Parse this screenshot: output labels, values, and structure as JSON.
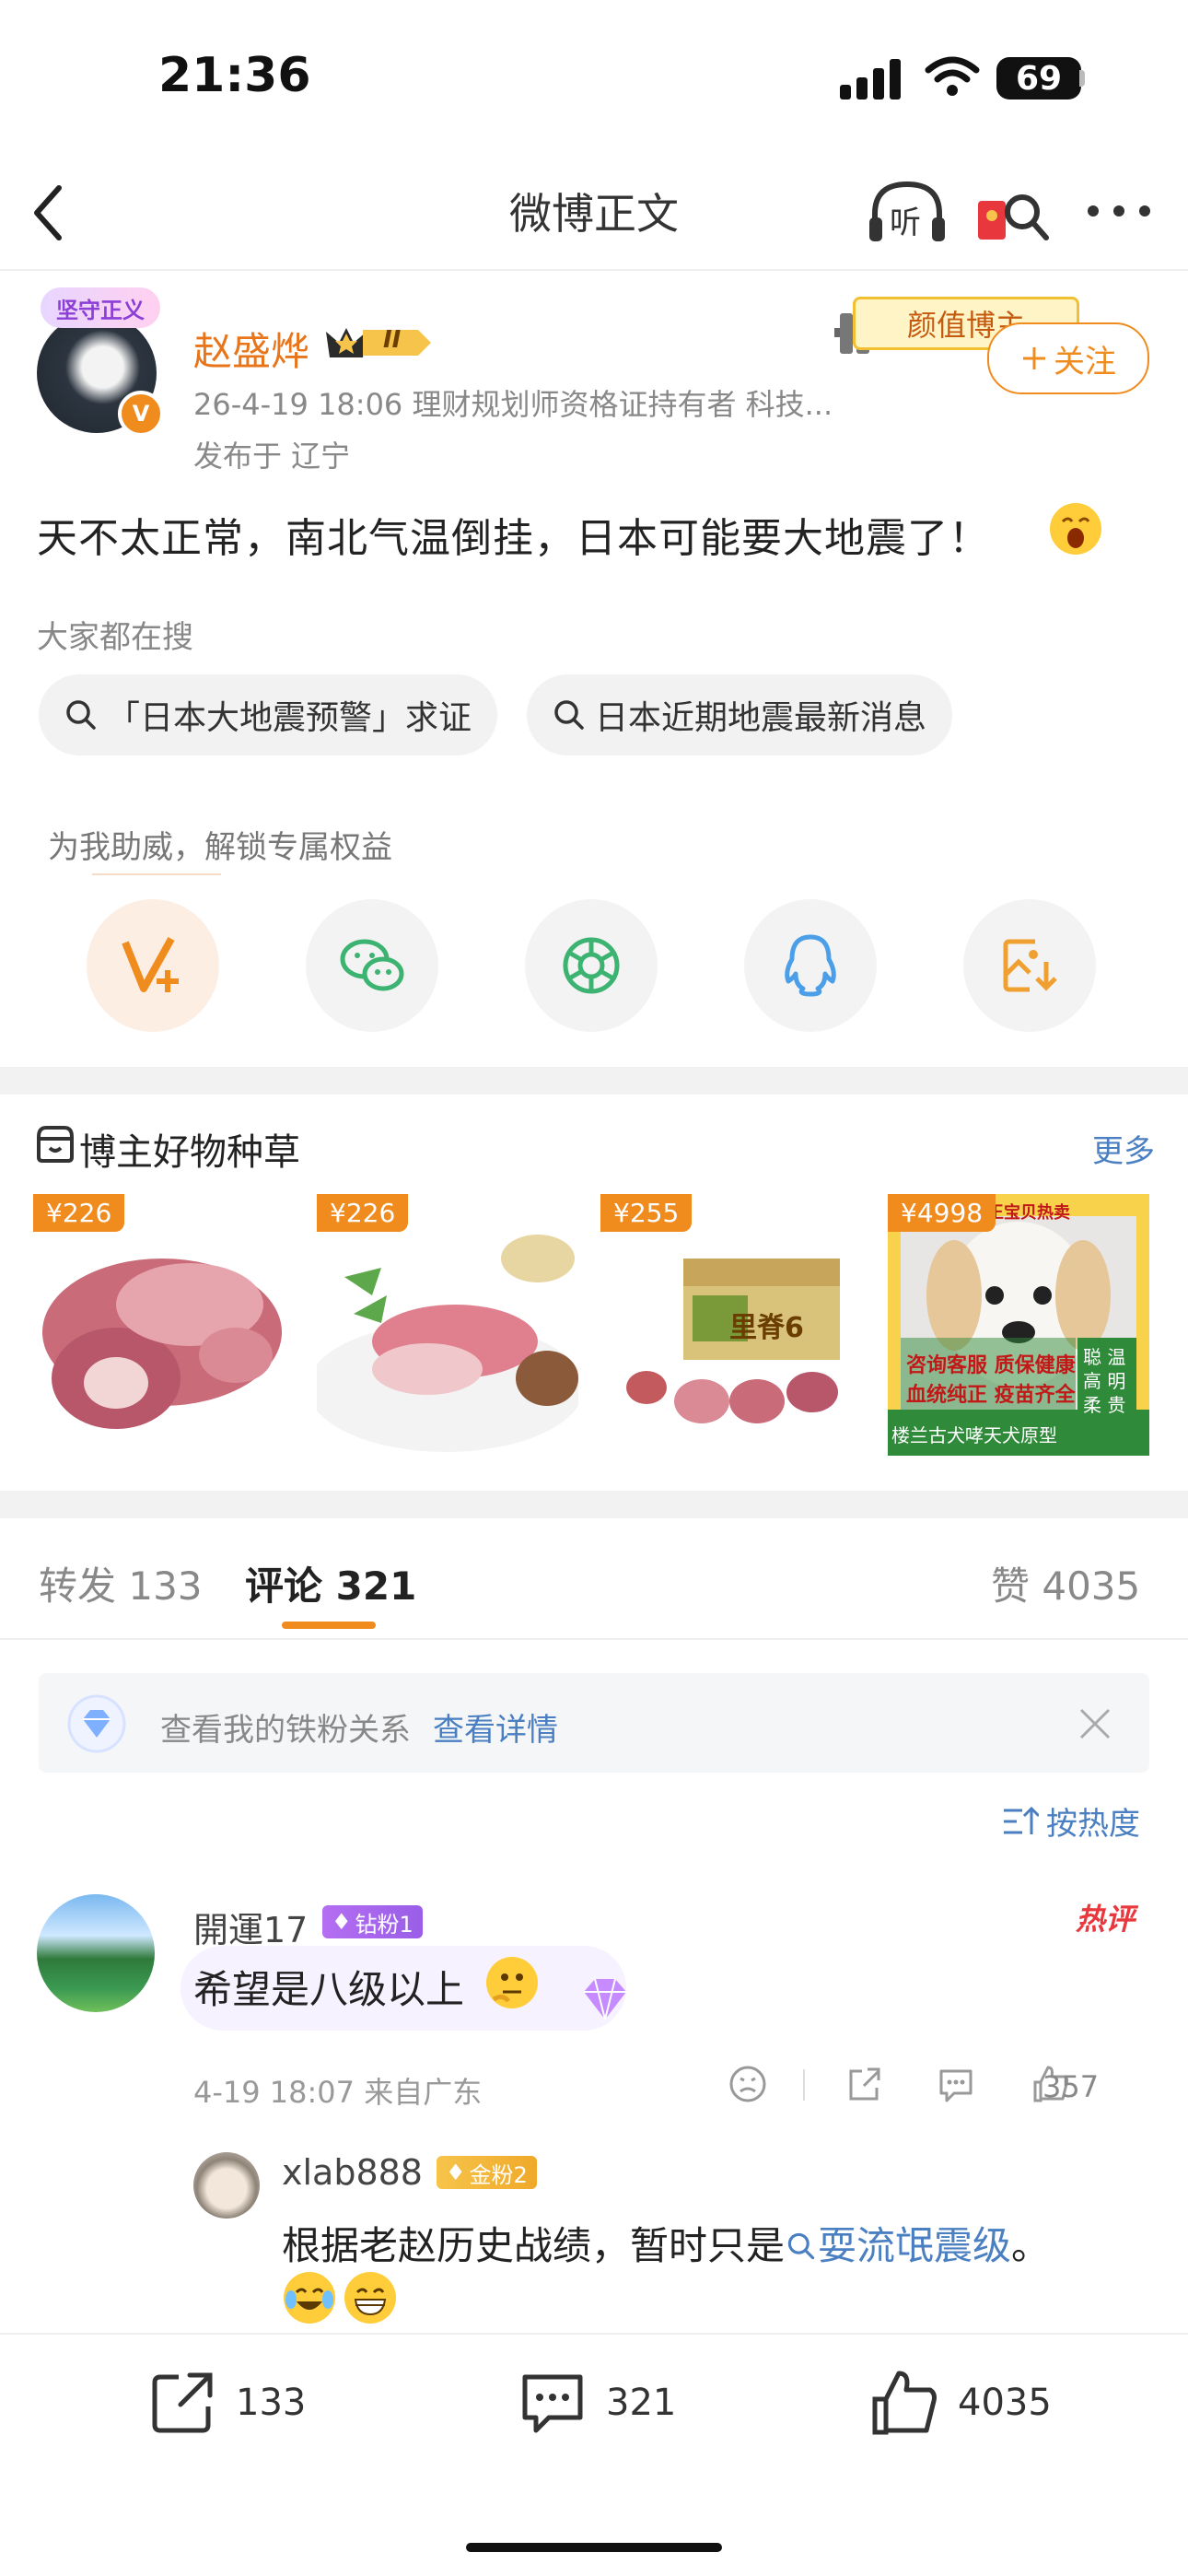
{
  "status_bar": {
    "time": "21:36",
    "battery": "69"
  },
  "nav": {
    "title": "微博正文",
    "listen_label": "听"
  },
  "post": {
    "avatar_badge": "坚守正义",
    "verify": "V",
    "username": "赵盛烨",
    "vip_level": "II",
    "meta": "26-4-19 18:06  理财规划师资格证持有者 科技...",
    "location": "发布于 辽宁",
    "creator_tag": "颜值博主",
    "follow_label": "关注",
    "text": "天不太正常，南北气温倒挂，日本可能要大地震了！",
    "search_heading": "大家都在搜",
    "search_chips": [
      "「日本大地震预警」求证",
      "日本近期地震最新消息"
    ],
    "unlock_text": "为我助威，解锁专属权益"
  },
  "shop": {
    "title": "博主好物种草",
    "more": "更多",
    "products": [
      {
        "price": "¥226"
      },
      {
        "price": "¥226"
      },
      {
        "price": "¥255",
        "box_text": "里脊6"
      },
      {
        "price": "¥4998",
        "top_text": "狗王宝贝热卖",
        "mid_text": "咨询客服 质保健康",
        "mid_text2": "血统纯正 疫苗齐全",
        "bottom_text": "楼兰古犬哮天犬原型",
        "side_text": "聪 温 高 明 柔 贵"
      }
    ]
  },
  "tabs": {
    "repost": "转发 133",
    "comment": "评论 321",
    "like": "赞 4035"
  },
  "fans_bar": {
    "text": "查看我的铁粉关系",
    "link": "查看详情"
  },
  "sort": "按热度",
  "comments": [
    {
      "name": "開運17",
      "badge": "钻粉1",
      "hot": "热评",
      "text": "希望是八级以上",
      "meta": "4-19 18:07  来自广东",
      "likes": "357"
    }
  ],
  "reply": {
    "name": "xlab888",
    "badge": "金粉2",
    "text": "根据老赵历史战绩，暂时只是",
    "link": "耍流氓震级",
    "end": "。"
  },
  "bottom_bar": {
    "repost": "133",
    "comment": "321",
    "like": "4035"
  },
  "colors": {
    "accent": "#f08b1e",
    "link": "#4a7fc1",
    "hot": "#e8383d"
  }
}
